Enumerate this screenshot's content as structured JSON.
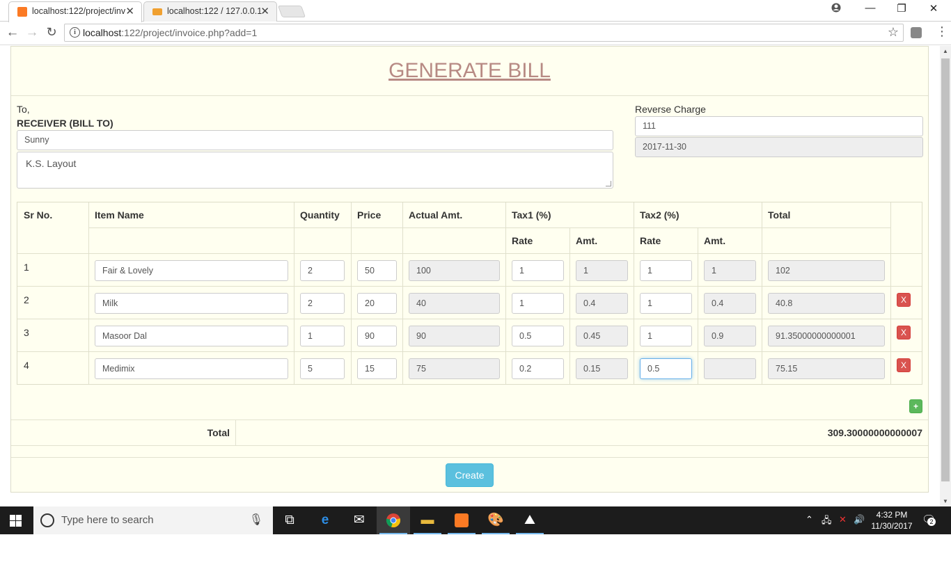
{
  "browser": {
    "tabs": [
      {
        "title": "localhost:122/project/inv",
        "active": true
      },
      {
        "title": "localhost:122 / 127.0.0.1",
        "active": false
      }
    ],
    "url_host": "localhost",
    "url_path": ":122/project/invoice.php?add=1"
  },
  "page": {
    "title": "GENERATE BILL",
    "to_label": "To,",
    "receiver_label": "RECEIVER (BILL TO)",
    "receiver_name": "Sunny",
    "receiver_address": "K.S. Layout",
    "reverse_charge_label": "Reverse Charge",
    "reverse_charge_value": "111",
    "date_value": "2017-11-30"
  },
  "table": {
    "headers": {
      "sr": "Sr No.",
      "item": "Item Name",
      "qty": "Quantity",
      "price": "Price",
      "actual": "Actual Amt.",
      "tax1": "Tax1 (%)",
      "tax2": "Tax2 (%)",
      "total": "Total",
      "rate1": "Rate",
      "amt1": "Amt.",
      "rate2": "Rate",
      "amt2": "Amt."
    },
    "rows": [
      {
        "sr": "1",
        "item": "Fair & Lovely",
        "qty": "2",
        "price": "50",
        "actual": "100",
        "rate1": "1",
        "amt1": "1",
        "rate2": "1",
        "amt2": "1",
        "total": "102"
      },
      {
        "sr": "2",
        "item": "Milk",
        "qty": "2",
        "price": "20",
        "actual": "40",
        "rate1": "1",
        "amt1": "0.4",
        "rate2": "1",
        "amt2": "0.4",
        "total": "40.8"
      },
      {
        "sr": "3",
        "item": "Masoor Dal",
        "qty": "1",
        "price": "90",
        "actual": "90",
        "rate1": "0.5",
        "amt1": "0.45",
        "rate2": "1",
        "amt2": "0.9",
        "total": "91.35000000000001"
      },
      {
        "sr": "4",
        "item": "Medimix",
        "qty": "5",
        "price": "15",
        "actual": "75",
        "rate1": "0.2",
        "amt1": "0.15",
        "rate2": "0.5",
        "amt2": "",
        "total": "75.15"
      }
    ],
    "delete_label": "X",
    "add_label": "+"
  },
  "summary": {
    "total_label": "Total",
    "total_value": "309.30000000000007"
  },
  "create_label": "Create",
  "taskbar": {
    "search_placeholder": "Type here to search",
    "time": "4:32 PM",
    "date": "11/30/2017",
    "notification_count": "2"
  },
  "colors": {
    "page_bg": "#fffff0",
    "title": "#b78a84",
    "delete_btn": "#d9534f",
    "add_btn": "#5cb85c",
    "create_btn": "#5bc0de"
  }
}
